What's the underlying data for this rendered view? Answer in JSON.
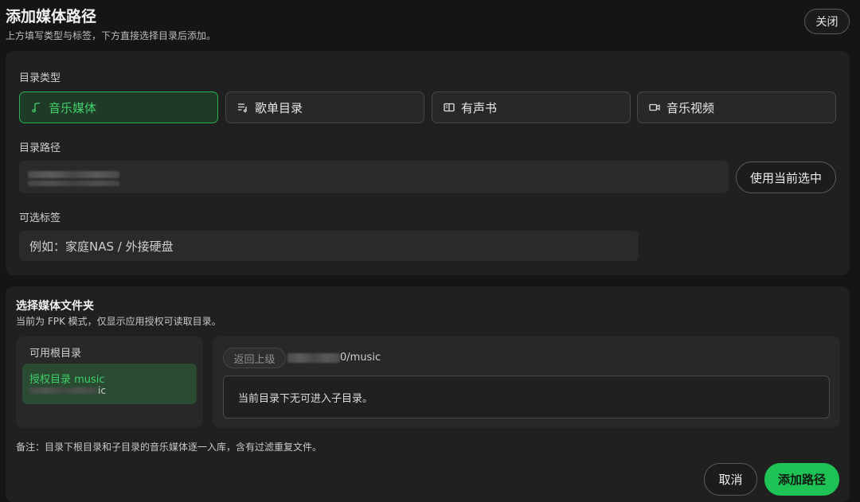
{
  "header": {
    "title": "添加媒体路径",
    "subtitle": "上方填写类型与标签，下方直接选择目录后添加。",
    "close_label": "关闭"
  },
  "form": {
    "type_label": "目录类型",
    "types": [
      {
        "label": "音乐媒体",
        "icon": "music-note-icon",
        "selected": true
      },
      {
        "label": "歌单目录",
        "icon": "playlist-icon",
        "selected": false
      },
      {
        "label": "有声书",
        "icon": "book-icon",
        "selected": false
      },
      {
        "label": "音乐视频",
        "icon": "video-icon",
        "selected": false
      }
    ],
    "path_label": "目录路径",
    "path_value_redacted": true,
    "use_current_label": "使用当前选中",
    "tag_label": "可选标签",
    "tag_placeholder": "例如：家庭NAS / 外接硬盘"
  },
  "picker": {
    "title": "选择媒体文件夹",
    "subtitle": "当前为 FPK 模式，仅显示应用授权可读取目录。",
    "roots_title": "可用根目录",
    "roots": [
      {
        "name": "授权目录 music",
        "path_suffix": "ic"
      }
    ],
    "back_label": "返回上级",
    "current_path_suffix": "0/music",
    "empty_message": "当前目录下无可进入子目录。",
    "note": "备注：目录下根目录和子目录的音乐媒体逐一入库，含有过滤重复文件。"
  },
  "footer": {
    "cancel_label": "取消",
    "add_label": "添加路径"
  },
  "colors": {
    "accent": "#1fc254",
    "accent_text": "#43d26c",
    "background": "#151515",
    "panel": "#202020"
  }
}
